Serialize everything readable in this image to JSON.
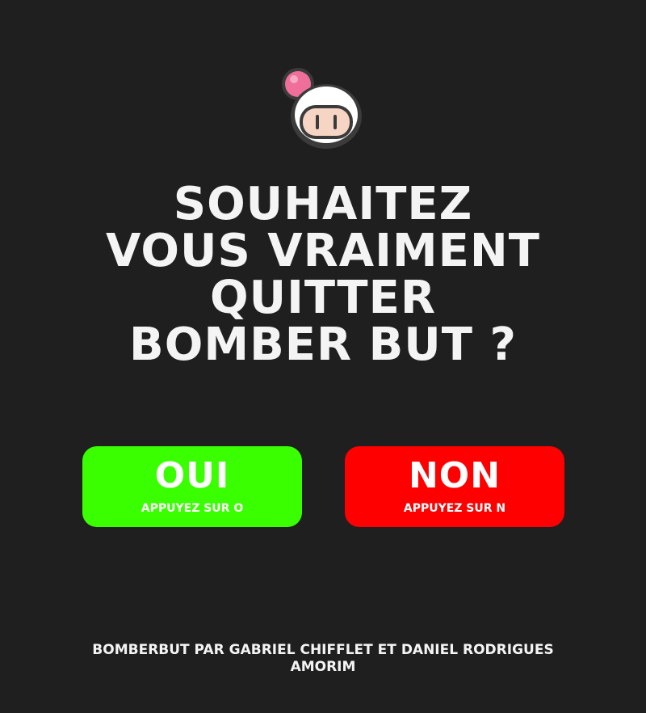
{
  "dialog": {
    "question_lines": [
      "SOUHAITEZ",
      "VOUS VRAIMENT",
      "QUITTER",
      "BOMBER BUT ?"
    ]
  },
  "buttons": {
    "yes": {
      "label": "OUI",
      "hint": "APPUYEZ SUR O",
      "color": "#39ff00"
    },
    "no": {
      "label": "NON",
      "hint": "APPUYEZ SUR N",
      "color": "#ff0000"
    }
  },
  "footer": {
    "credits": "BOMBERBUT PAR GABRIEL CHIFFLET ET DANIEL RODRIGUES AMORIM"
  },
  "logo": {
    "icon": "bomberman-head-icon"
  },
  "colors": {
    "background": "#1f1f1f",
    "text": "#f4f4f4"
  }
}
